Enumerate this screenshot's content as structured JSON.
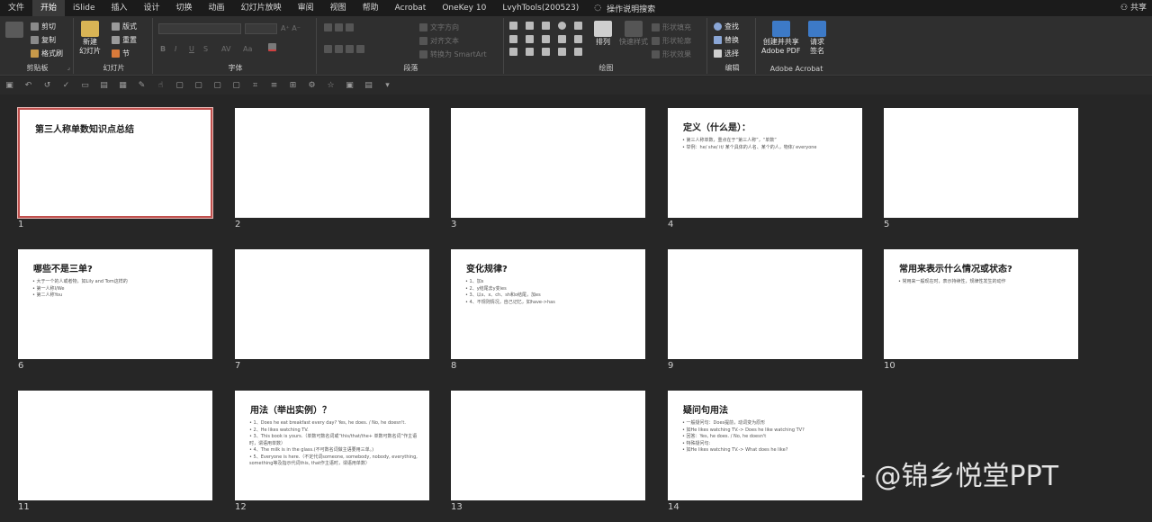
{
  "menu": {
    "tabs": [
      "文件",
      "开始",
      "iSlide",
      "插入",
      "设计",
      "切换",
      "动画",
      "幻灯片放映",
      "审阅",
      "视图",
      "帮助",
      "Acrobat",
      "OneKey 10",
      "LvyhTools(200523)"
    ],
    "active_tab": "开始",
    "tell_me": "操作说明搜索",
    "share": "共享"
  },
  "ribbon": {
    "clipboard": {
      "cut": "剪切",
      "copy": "复制",
      "format_painter": "格式刷",
      "label": "剪贴板"
    },
    "slides": {
      "new_slide": "新建\n幻灯片",
      "layout": "版式",
      "reset": "重置",
      "section": "节",
      "label": "幻灯片"
    },
    "font": {
      "label": "字体",
      "size_buttons": "A⁺ A⁻",
      "bold": "B",
      "italic": "I",
      "underline": "U",
      "strike": "S",
      "spacing": "AV",
      "case": "Aa"
    },
    "paragraph": {
      "text_direction": "文字方向",
      "align_text": "对齐文本",
      "smartart": "转换为 SmartArt",
      "label": "段落"
    },
    "drawing": {
      "arrange": "排列",
      "quick_styles": "快速样式",
      "fill": "形状填充",
      "outline": "形状轮廓",
      "effects": "形状效果",
      "label": "绘图"
    },
    "editing": {
      "find": "查找",
      "replace": "替换",
      "select": "选择",
      "label": "编辑"
    },
    "acrobat": {
      "create_share": "创建并共享\nAdobe PDF",
      "request_sign": "请求\n签名",
      "label": "Adobe Acrobat"
    }
  },
  "slides": [
    {
      "num": "1",
      "title": "第三人称单数知识点总结",
      "body": []
    },
    {
      "num": "2",
      "title": "",
      "body": []
    },
    {
      "num": "3",
      "title": "",
      "body": []
    },
    {
      "num": "4",
      "title": "定义（什么是）：",
      "body": [
        "• 第三人称单数，重点在于“第三人称”，“单数”",
        "• 举例：he/ she/ it/ 某个具体的人名、某个的人，物体/ everyone"
      ]
    },
    {
      "num": "5",
      "title": "",
      "body": []
    },
    {
      "num": "6",
      "title": "哪些不是三单?",
      "body": [
        "• 大于一个的人或者物，如Lily and Tom这样的",
        "• 第一人称I/We",
        "• 第二人称You"
      ]
    },
    {
      "num": "7",
      "title": "",
      "body": []
    },
    {
      "num": "8",
      "title": "变化规律?",
      "body": [
        "• 1、加s",
        "• 2、y结尾去y变ies",
        "• 3、以s、x、ch、sh和o结尾，加es",
        "• 4、不规则情况，自己记忆，如have->has"
      ]
    },
    {
      "num": "9",
      "title": "",
      "body": []
    },
    {
      "num": "10",
      "title": "常用来表示什么情况或状态?",
      "body": [
        "• 常用来一般现在时，表示持续性，规律性发生的动作"
      ]
    },
    {
      "num": "11",
      "title": "",
      "body": []
    },
    {
      "num": "12",
      "title": "用法（举出实例）？",
      "body": [
        "• 1、Does he eat breakfast every day? Yes, he does. / No, he doesn't.",
        "• 2、He likes watching TV.",
        "• 3、This book is yours.（单数可数名词或“this/that/the+ 单数可数名词”作主语时，谓语用单数）",
        "• 4、The milk is in the glass.(不可数名词做主语要用三单。)",
        "• 5、Everyone is here.（不定代词someone, somebody, nobody, everything, something等及指示代词this, that作主语时，谓语用单数）"
      ]
    },
    {
      "num": "13",
      "title": "",
      "body": []
    },
    {
      "num": "14",
      "title": "疑问句用法",
      "body": [
        "• 一般疑问句：Does提前，动词变为原形",
        "• 如He likes watching TV.-> Does he like watching TV?",
        "• 回答：Yes, he does. / No, he doesn't",
        "• 特殊疑问句:",
        "• 如He likes watching TV.-> What does he like?"
      ]
    }
  ],
  "watermark": "知乎 @锦乡悦堂PPT"
}
